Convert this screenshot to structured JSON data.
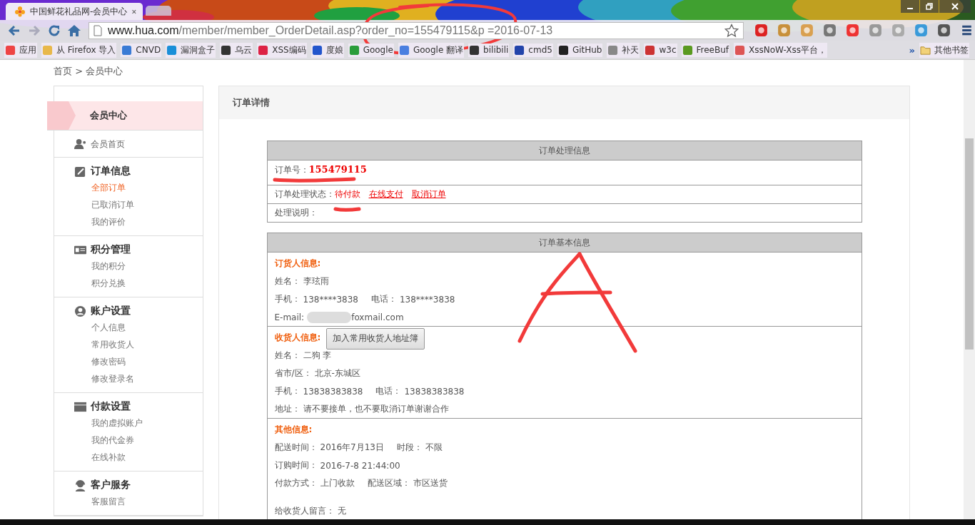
{
  "browser": {
    "tabs": [
      {
        "title": "中国鲜花礼品网-会员中心",
        "selected": true
      },
      {
        "selected": false
      }
    ],
    "url": {
      "host": "www.hua.com",
      "path": "/member/member_OrderDetail.asp?order_no=155479115&p =2016-07-13"
    },
    "bookmarks": [
      "应用",
      "从 Firefox 导入",
      "CNVD",
      "漏洞盒子",
      "乌云",
      "XSS编码",
      "度娘",
      "Google",
      "Google 翻译",
      "bilibili",
      "cmd5",
      "GitHub",
      "补天",
      "w3c",
      "FreeBuf",
      "XssNoW-Xss平台，"
    ],
    "more_bookmarks": "»",
    "other_bookmarks": "其他书签"
  },
  "breadcrumb": "首页 > 会员中心",
  "sidebar": {
    "title": "会员中心",
    "sections": [
      {
        "heading": "会员首页",
        "kind": "link"
      },
      {
        "heading": "订单信息",
        "kind": "group",
        "links": [
          {
            "label": "全部订单",
            "selected": true
          },
          {
            "label": "已取消订单",
            "selected": false
          },
          {
            "label": "我的评价",
            "selected": false
          }
        ]
      },
      {
        "heading": "积分管理",
        "kind": "group",
        "links": [
          {
            "label": "我的积分",
            "selected": false
          },
          {
            "label": "积分兑换",
            "selected": false
          }
        ]
      },
      {
        "heading": "账户设置",
        "kind": "group",
        "links": [
          {
            "label": "个人信息",
            "selected": false
          },
          {
            "label": "常用收货人",
            "selected": false
          },
          {
            "label": "修改密码",
            "selected": false
          },
          {
            "label": "修改登录名",
            "selected": false
          }
        ]
      },
      {
        "heading": "付款设置",
        "kind": "group",
        "links": [
          {
            "label": "我的虚拟账户",
            "selected": false
          },
          {
            "label": "我的代金券",
            "selected": false
          },
          {
            "label": "在线补款",
            "selected": false
          }
        ]
      },
      {
        "heading": "客户服务",
        "kind": "group",
        "links": [
          {
            "label": "客服留言",
            "selected": false
          }
        ]
      }
    ]
  },
  "panel": {
    "title": "订单详情",
    "process": {
      "header": "订单处理信息",
      "order_no_label": "订单号：",
      "order_no": "155479115",
      "status_label": "订单处理状态：",
      "status": "待付款",
      "actions": [
        "在线支付",
        "取消订单"
      ],
      "note_label": "处理说明："
    },
    "basic": {
      "header": "订单基本信息",
      "sections": [
        {
          "heading": "订货人信息:",
          "rows": [
            [
              {
                "label": "姓名：",
                "value": "李玹雨"
              }
            ],
            [
              {
                "label": "手机：",
                "value": "138****3838"
              },
              {
                "label": "电话：",
                "value": "138****3838"
              }
            ],
            [
              {
                "label": "E-mail:",
                "value": "foxmail.com",
                "blurred": true
              }
            ]
          ]
        },
        {
          "heading": "收货人信息:",
          "button": "加入常用收货人地址簿",
          "rows": [
            [
              {
                "label": "姓名：",
                "value": "二狗 李"
              }
            ],
            [
              {
                "label": "省市/区：",
                "value": "北京-东城区"
              }
            ],
            [
              {
                "label": "手机：",
                "value": "13838383838"
              },
              {
                "label": "电话：",
                "value": "13838383838"
              }
            ],
            [
              {
                "label": "地址：",
                "value": "请不要接单，也不要取消订单谢谢合作"
              }
            ]
          ]
        },
        {
          "heading": "其他信息:",
          "rows": [
            [
              {
                "label": "配送时间：",
                "value": "2016年7月13日"
              },
              {
                "label": "时段：",
                "value": "不限"
              }
            ],
            [
              {
                "label": "订购时间：",
                "value": "2016-7-8 21:44:00"
              }
            ],
            [
              {
                "label": "付款方式：",
                "value": "上门收款"
              },
              {
                "label": "配送区域：",
                "value": "市区送货"
              }
            ],
            [
              {
                "label": "给收货人留言：",
                "value": "无",
                "gap": true
              }
            ]
          ]
        }
      ]
    }
  }
}
